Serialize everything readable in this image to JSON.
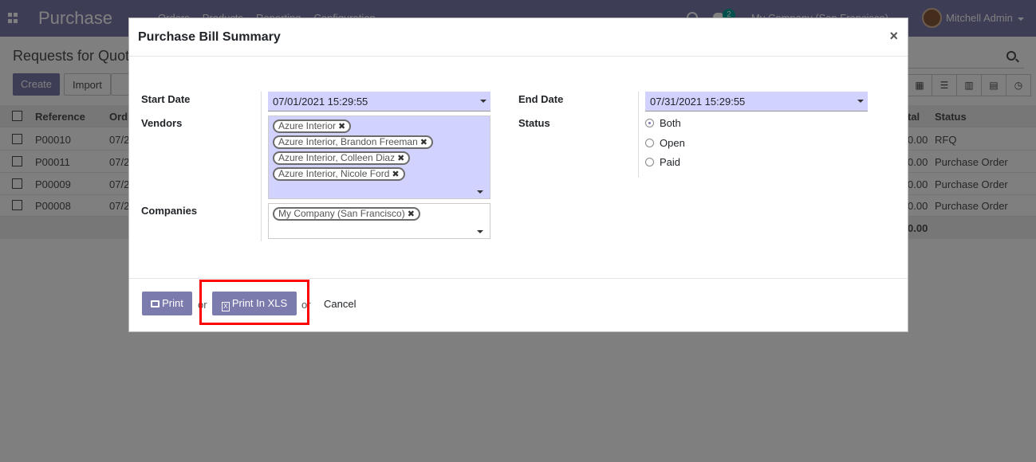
{
  "app": {
    "title": "Purchase",
    "menu": [
      "Orders",
      "Products",
      "Reporting",
      "Configuration"
    ],
    "chat_count": "2",
    "company": "My Company (San Francisco)",
    "user": "Mitchell Admin"
  },
  "page": {
    "breadcrumb": "Requests for Quot",
    "create_label": "Create",
    "import_label": "Import"
  },
  "list": {
    "headers": [
      "Reference",
      "Ord",
      "tal",
      "Status"
    ],
    "rows": [
      {
        "ref": "P00010",
        "date": "07/2",
        "total": "0.00",
        "status": "RFQ"
      },
      {
        "ref": "P00011",
        "date": "07/2",
        "total": "0.00",
        "status": "Purchase Order"
      },
      {
        "ref": "P00009",
        "date": "07/2",
        "total": "0.00",
        "status": "Purchase Order"
      },
      {
        "ref": "P00008",
        "date": "07/2",
        "total": "0.00",
        "status": "Purchase Order"
      }
    ],
    "footer_total": "0.00"
  },
  "modal": {
    "title": "Purchase Bill Summary",
    "close": "×",
    "start_date_label": "Start Date",
    "start_date": "07/01/2021 15:29:55",
    "end_date_label": "End Date",
    "end_date": "07/31/2021 15:29:55",
    "vendors_label": "Vendors",
    "vendors": [
      "Azure Interior",
      "Azure Interior, Brandon Freeman",
      "Azure Interior, Colleen Diaz",
      "Azure Interior, Nicole Ford"
    ],
    "status_label": "Status",
    "status_options": [
      "Both",
      "Open",
      "Paid"
    ],
    "status_selected": "Both",
    "companies_label": "Companies",
    "companies": [
      "My Company (San Francisco)"
    ],
    "print_label": "Print",
    "or_text": "or",
    "print_xls_label": "Print In XLS",
    "cancel_label": "Cancel",
    "tag_remove": "✖"
  },
  "colors": {
    "primary": "#7c7bad",
    "required_field": "#d2d2ff",
    "highlight": "#ff0000"
  }
}
